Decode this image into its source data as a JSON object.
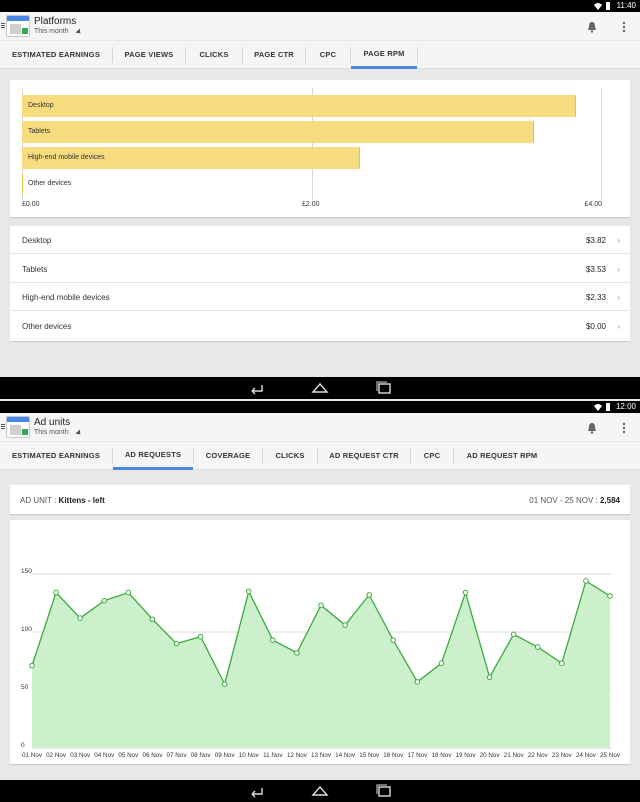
{
  "screen1": {
    "status_time": "11:40",
    "app_title": "Platforms",
    "app_subtitle": "This month",
    "tabs": [
      {
        "label": "ESTIMATED EARNINGS",
        "active": false
      },
      {
        "label": "PAGE VIEWS",
        "active": false
      },
      {
        "label": "CLICKS",
        "active": false
      },
      {
        "label": "PAGE CTR",
        "active": false
      },
      {
        "label": "CPC",
        "active": false
      },
      {
        "label": "PAGE RPM",
        "active": true
      }
    ],
    "chart_data": {
      "type": "bar",
      "orientation": "horizontal",
      "categories": [
        "Desktop",
        "Tablets",
        "High-end mobile devices",
        "Other devices"
      ],
      "values": [
        3.82,
        3.53,
        2.33,
        0.0
      ],
      "xlim": [
        0,
        4
      ],
      "x_tick_labels": [
        "£0.00",
        "£2.00",
        "£4.00"
      ],
      "bar_color": "#f6dc7f",
      "grid": true
    },
    "rows": [
      {
        "name": "Desktop",
        "value": "$3.82"
      },
      {
        "name": "Tablets",
        "value": "$3.53"
      },
      {
        "name": "High-end mobile devices",
        "value": "$2.33"
      },
      {
        "name": "Other devices",
        "value": "$0.00"
      }
    ],
    "chevron": "›"
  },
  "screen2": {
    "status_time": "12:00",
    "app_title": "Ad units",
    "app_subtitle": "This month",
    "tabs": [
      {
        "label": "ESTIMATED EARNINGS",
        "active": false
      },
      {
        "label": "AD REQUESTS",
        "active": true
      },
      {
        "label": "COVERAGE",
        "active": false
      },
      {
        "label": "CLICKS",
        "active": false
      },
      {
        "label": "AD REQUEST CTR",
        "active": false
      },
      {
        "label": "CPC",
        "active": false
      },
      {
        "label": "AD REQUEST RPM",
        "active": false
      }
    ],
    "ad_unit_label": "AD UNIT :",
    "ad_unit_name": "Kittens - left",
    "date_range": "01 NOV - 25 NOV :",
    "total": "2,584",
    "chart_data": {
      "type": "area",
      "x": [
        "01 Nov",
        "02 Nov",
        "03 Nov",
        "04 Nov",
        "05 Nov",
        "06 Nov",
        "07 Nov",
        "08 Nov",
        "09 Nov",
        "10 Nov",
        "11 Nov",
        "12 Nov",
        "13 Nov",
        "14 Nov",
        "15 Nov",
        "16 Nov",
        "17 Nov",
        "18 Nov",
        "19 Nov",
        "20 Nov",
        "21 Nov",
        "22 Nov",
        "23 Nov",
        "24 Nov",
        "25 Nov"
      ],
      "values": [
        71,
        134,
        112,
        127,
        134,
        111,
        90,
        96,
        55,
        135,
        93,
        82,
        123,
        106,
        132,
        93,
        57,
        73,
        134,
        61,
        98,
        87,
        73,
        144,
        131
      ],
      "ylim": [
        0,
        150
      ],
      "y_ticks": [
        0,
        50,
        100,
        150
      ],
      "line_color": "#3cab3c",
      "fill_color": "#ccefcc",
      "grid": true
    }
  }
}
